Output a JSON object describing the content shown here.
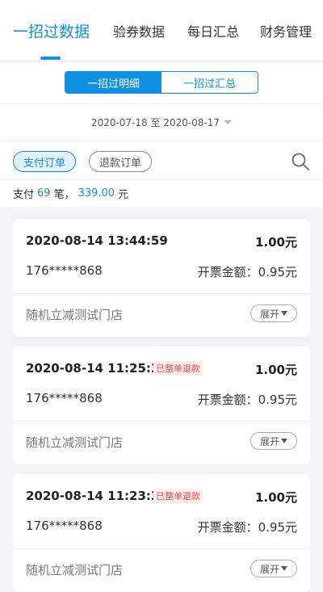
{
  "tabs": [
    {
      "label": "一招过数据",
      "active": true
    },
    {
      "label": "验券数据",
      "active": false
    },
    {
      "label": "每日汇总",
      "active": false
    },
    {
      "label": "财务管理",
      "active": false
    }
  ],
  "segments": [
    {
      "label": "一招过明细",
      "active": true
    },
    {
      "label": "一招过汇总",
      "active": false
    }
  ],
  "date_range": "2020-07-18 至 2020-08-17",
  "filters": [
    {
      "label": "支付订单",
      "active": true
    },
    {
      "label": "退款订单",
      "active": false
    }
  ],
  "summary": {
    "prefix": "支付",
    "count": "69",
    "count_unit": "笔，",
    "amount": "339.00",
    "amount_unit": "元"
  },
  "orders": [
    {
      "time": "2020-08-14 13:44:59",
      "badge": "",
      "amount": "1.00元",
      "phone": "176*****868",
      "invoice": "开票金额：0.95元",
      "store": "随机立减测试门店",
      "expand": "展开"
    },
    {
      "time": "2020-08-14 11:25:37",
      "badge": "已整单退款",
      "amount": "1.00元",
      "phone": "176*****868",
      "invoice": "开票金额：0.95元",
      "store": "随机立减测试门店",
      "expand": "展开"
    },
    {
      "time": "2020-08-14 11:23:37",
      "badge": "已整单退款",
      "amount": "1.00元",
      "phone": "176*****868",
      "invoice": "开票金额：0.95元",
      "store": "随机立减测试门店",
      "expand": "展开"
    }
  ],
  "colors": {
    "accent": "#1190e0",
    "refund": "#e84d4d"
  }
}
